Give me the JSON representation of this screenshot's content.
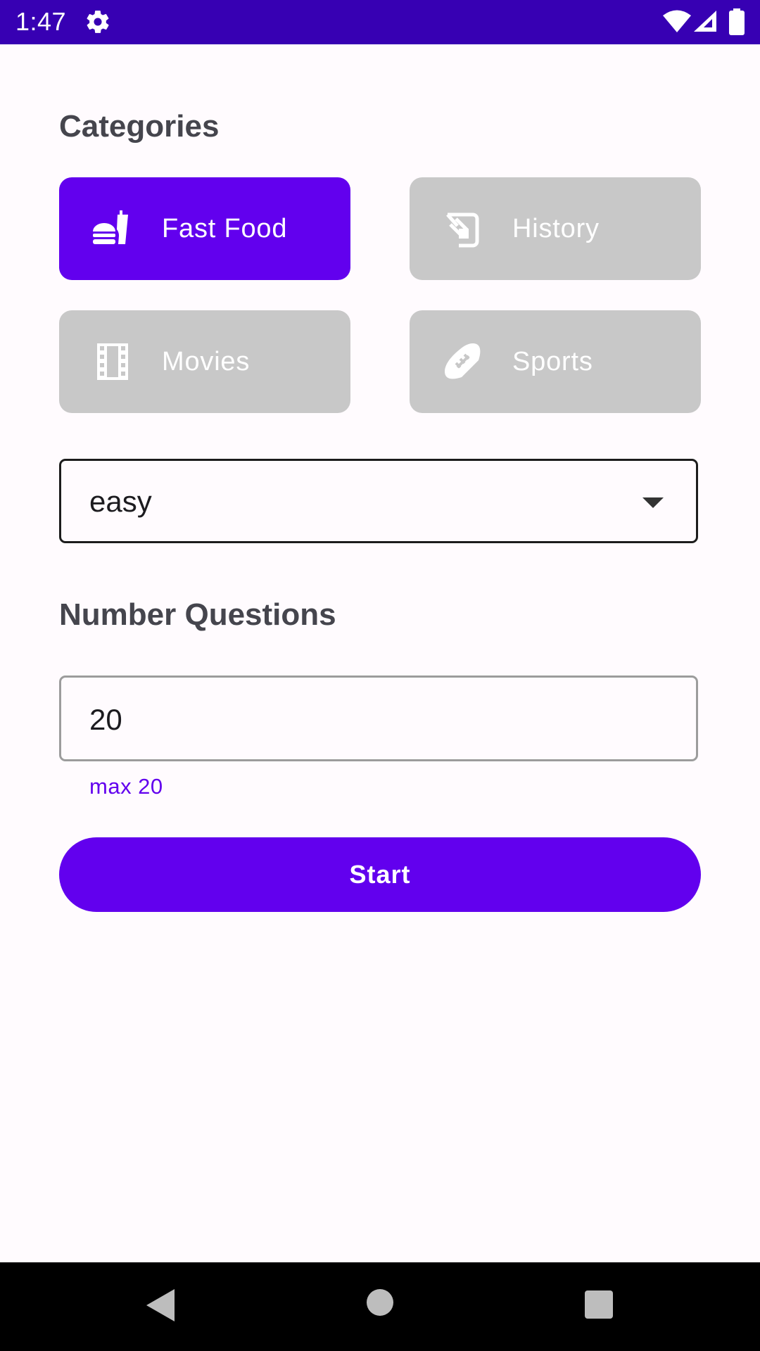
{
  "status_bar": {
    "time": "1:47",
    "icons": [
      "gear-icon",
      "wifi-icon",
      "signal-icon",
      "battery-icon"
    ],
    "background": "#3700B3"
  },
  "categories": {
    "title": "Categories",
    "items": [
      {
        "label": "Fast Food",
        "icon": "fast-food-icon",
        "selected": true
      },
      {
        "label": "History",
        "icon": "history-icon",
        "selected": false
      },
      {
        "label": "Movies",
        "icon": "film-icon",
        "selected": false
      },
      {
        "label": "Sports",
        "icon": "football-icon",
        "selected": false
      }
    ]
  },
  "difficulty": {
    "value": "easy"
  },
  "number_questions": {
    "title": "Number Questions",
    "value": "20",
    "helper": "max 20"
  },
  "start_button": {
    "label": "Start"
  },
  "colors": {
    "accent": "#6200EE",
    "inactive": "#C8C8C8",
    "background": "#FFFBFE"
  },
  "nav_bar": {
    "icons": [
      "back-icon",
      "home-icon",
      "recents-icon"
    ]
  }
}
